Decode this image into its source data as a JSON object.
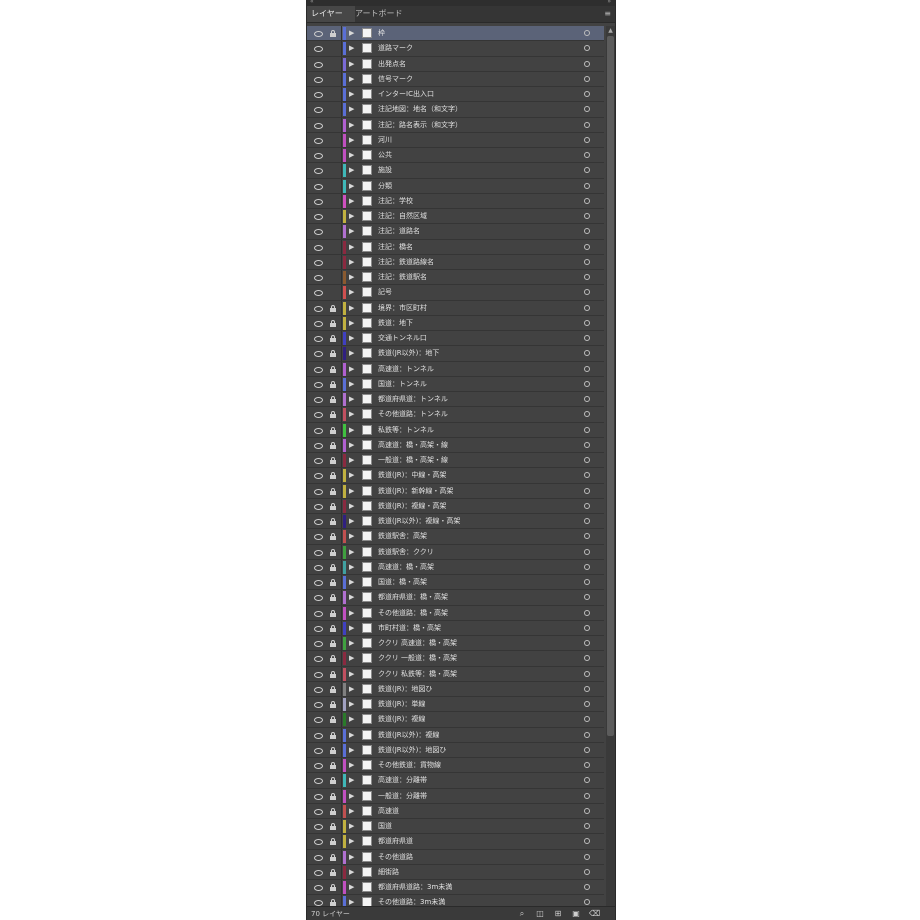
{
  "panel": {
    "tabs": [
      "レイヤー",
      "アートボード"
    ],
    "menu_icon": "≡",
    "footer": {
      "layer_count": "70 レイヤー"
    }
  },
  "layers": [
    {
      "name": "枠",
      "color": "#5a6fd6",
      "locked": true,
      "selected": true
    },
    {
      "name": "道路マーク",
      "color": "#5a6fd6",
      "locked": false
    },
    {
      "name": "出発点名",
      "color": "#7a6ad6",
      "locked": false
    },
    {
      "name": "信号マーク",
      "color": "#5a6fd6",
      "locked": false
    },
    {
      "name": "インターIC出入口",
      "color": "#5a6fd6",
      "locked": false
    },
    {
      "name": "注記地図：地名（和文字）",
      "color": "#5a6fd6",
      "locked": false
    },
    {
      "name": "注記：路名表示（和文字）",
      "color": "#b060d0",
      "locked": false
    },
    {
      "name": "河川",
      "color": "#c050c0",
      "locked": false
    },
    {
      "name": "公共",
      "color": "#c050c0",
      "locked": false
    },
    {
      "name": "施設",
      "color": "#3fb7b7",
      "locked": false
    },
    {
      "name": "分類",
      "color": "#3fb7b7",
      "locked": false
    },
    {
      "name": "注記：学校",
      "color": "#d050c0",
      "locked": false
    },
    {
      "name": "注記：自然区域",
      "color": "#c0b040",
      "locked": false
    },
    {
      "name": "注記：道路名",
      "color": "#b070d0",
      "locked": false
    },
    {
      "name": "注記：橋名",
      "color": "#8a2a40",
      "locked": false
    },
    {
      "name": "注記：鉄道路線名",
      "color": "#8a2a40",
      "locked": false
    },
    {
      "name": "注記：鉄道駅名",
      "color": "#8a5a30",
      "locked": false
    },
    {
      "name": "記号",
      "color": "#cf5050",
      "locked": false
    },
    {
      "name": "境界：市区町村",
      "color": "#c0b040",
      "locked": true
    },
    {
      "name": "鉄道：地下",
      "color": "#c0b040",
      "locked": true
    },
    {
      "name": "交通トンネル口",
      "color": "#4040c0",
      "locked": true
    },
    {
      "name": "鉄道(JR以外)：地下",
      "color": "#302080",
      "locked": true
    },
    {
      "name": "高速道：トンネル",
      "color": "#b060d0",
      "locked": true
    },
    {
      "name": "国道：トンネル",
      "color": "#5a6fd6",
      "locked": true
    },
    {
      "name": "都道府県道：トンネル",
      "color": "#b070d0",
      "locked": true
    },
    {
      "name": "その他道路：トンネル",
      "color": "#c05060",
      "locked": true
    },
    {
      "name": "私鉄等：トンネル",
      "color": "#40c040",
      "locked": true
    },
    {
      "name": "高速道：橋・高架・線",
      "color": "#b060d0",
      "locked": true
    },
    {
      "name": "一般道：橋・高架・線",
      "color": "#8a2a40",
      "locked": true
    },
    {
      "name": "鉄道(JR)：中線・高架",
      "color": "#c0b040",
      "locked": true
    },
    {
      "name": "鉄道(JR)：新幹線・高架",
      "color": "#c0b040",
      "locked": true
    },
    {
      "name": "鉄道(JR)：複線・高架",
      "color": "#8a2a40",
      "locked": true
    },
    {
      "name": "鉄道(JR以外)：複線・高架",
      "color": "#302080",
      "locked": true
    },
    {
      "name": "鉄道駅舎：高架",
      "color": "#c05050",
      "locked": true
    },
    {
      "name": "鉄道駅舎：ククリ",
      "color": "#40a040",
      "locked": true
    },
    {
      "name": "高速道：橋・高架",
      "color": "#40a0a0",
      "locked": true
    },
    {
      "name": "国道：橋・高架",
      "color": "#5a6fd6",
      "locked": true
    },
    {
      "name": "都道府県道：橋・高架",
      "color": "#b070d0",
      "locked": true
    },
    {
      "name": "その他道路：橋・高架",
      "color": "#c050c0",
      "locked": true
    },
    {
      "name": "市町村道：橋・高架",
      "color": "#4040c0",
      "locked": true
    },
    {
      "name": "ククリ 高速道：橋・高架",
      "color": "#40a040",
      "locked": true
    },
    {
      "name": "ククリ 一般道：橋・高架",
      "color": "#8a2a40",
      "locked": true
    },
    {
      "name": "ククリ 私鉄等：橋・高架",
      "color": "#c05060",
      "locked": true
    },
    {
      "name": "鉄道(JR)：地図ひ",
      "color": "#808080",
      "locked": true
    },
    {
      "name": "鉄道(JR)：単線",
      "color": "#a0a0c0",
      "locked": true
    },
    {
      "name": "鉄道(JR)：複線",
      "color": "#2a7a2a",
      "locked": true
    },
    {
      "name": "鉄道(JR以外)：複線",
      "color": "#5a6fd6",
      "locked": true
    },
    {
      "name": "鉄道(JR以外)：地図ひ",
      "color": "#5a6fd6",
      "locked": true
    },
    {
      "name": "その他鉄道：貨物線",
      "color": "#c050c0",
      "locked": true
    },
    {
      "name": "高速道：分離帯",
      "color": "#3fb7b7",
      "locked": true
    },
    {
      "name": "一般道：分離帯",
      "color": "#c050c0",
      "locked": true
    },
    {
      "name": "高速道",
      "color": "#c05050",
      "locked": true
    },
    {
      "name": "国道",
      "color": "#c0b040",
      "locked": true
    },
    {
      "name": "都道府県道",
      "color": "#c0b040",
      "locked": true
    },
    {
      "name": "その他道路",
      "color": "#b070d0",
      "locked": true
    },
    {
      "name": "細街路",
      "color": "#8a2a40",
      "locked": true
    },
    {
      "name": "都道府県道路：3m未満",
      "color": "#c050c0",
      "locked": true
    },
    {
      "name": "その他道路：3m未満",
      "color": "#5a6fd6",
      "locked": true
    }
  ]
}
